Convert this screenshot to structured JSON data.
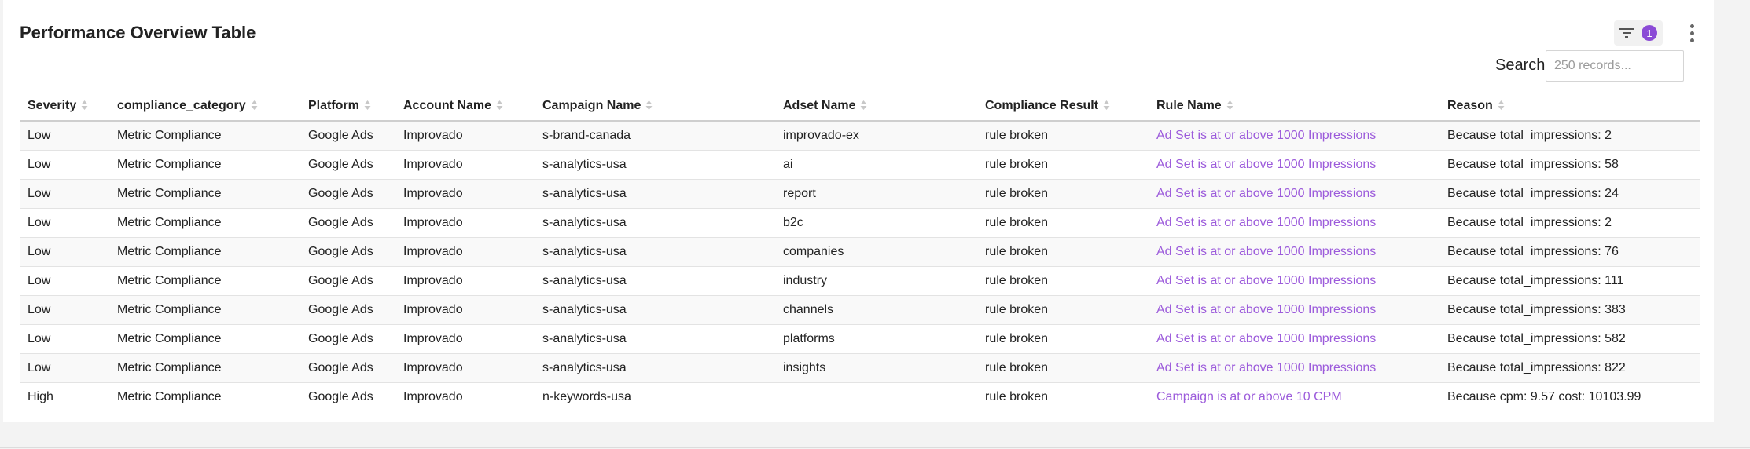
{
  "header": {
    "title": "Performance Overview Table",
    "filter_badge": "1",
    "filter_icon": "filter-icon",
    "menu_icon": "more-vertical-icon"
  },
  "search": {
    "label": "Search",
    "placeholder": "250 records...",
    "value": ""
  },
  "table": {
    "columns": [
      "Severity",
      "compliance_category",
      "Platform",
      "Account Name",
      "Campaign Name",
      "Adset Name",
      "Compliance Result",
      "Rule Name",
      "Reason"
    ],
    "rows": [
      [
        "Low",
        "Metric Compliance",
        "Google Ads",
        "Improvado",
        "s-brand-canada",
        "improvado-ex",
        "rule broken",
        "Ad Set is at or above 1000 Impressions",
        "Because total_impressions: 2"
      ],
      [
        "Low",
        "Metric Compliance",
        "Google Ads",
        "Improvado",
        "s-analytics-usa",
        "ai",
        "rule broken",
        "Ad Set is at or above 1000 Impressions",
        "Because total_impressions: 58"
      ],
      [
        "Low",
        "Metric Compliance",
        "Google Ads",
        "Improvado",
        "s-analytics-usa",
        "report",
        "rule broken",
        "Ad Set is at or above 1000 Impressions",
        "Because total_impressions: 24"
      ],
      [
        "Low",
        "Metric Compliance",
        "Google Ads",
        "Improvado",
        "s-analytics-usa",
        "b2c",
        "rule broken",
        "Ad Set is at or above 1000 Impressions",
        "Because total_impressions: 2"
      ],
      [
        "Low",
        "Metric Compliance",
        "Google Ads",
        "Improvado",
        "s-analytics-usa",
        "companies",
        "rule broken",
        "Ad Set is at or above 1000 Impressions",
        "Because total_impressions: 76"
      ],
      [
        "Low",
        "Metric Compliance",
        "Google Ads",
        "Improvado",
        "s-analytics-usa",
        "industry",
        "rule broken",
        "Ad Set is at or above 1000 Impressions",
        "Because total_impressions: 111"
      ],
      [
        "Low",
        "Metric Compliance",
        "Google Ads",
        "Improvado",
        "s-analytics-usa",
        "channels",
        "rule broken",
        "Ad Set is at or above 1000 Impressions",
        "Because total_impressions: 383"
      ],
      [
        "Low",
        "Metric Compliance",
        "Google Ads",
        "Improvado",
        "s-analytics-usa",
        "platforms",
        "rule broken",
        "Ad Set is at or above 1000 Impressions",
        "Because total_impressions: 582"
      ],
      [
        "Low",
        "Metric Compliance",
        "Google Ads",
        "Improvado",
        "s-analytics-usa",
        "insights",
        "rule broken",
        "Ad Set is at or above 1000 Impressions",
        "Because total_impressions: 822"
      ],
      [
        "High",
        "Metric Compliance",
        "Google Ads",
        "Improvado",
        "n-keywords-usa",
        "",
        "rule broken",
        "Campaign is at or above 10 CPM",
        "Because cpm: 9.57 cost: 10103.99"
      ]
    ]
  },
  "colors": {
    "accent": "#8b4bd6",
    "link": "#9c5bdb"
  }
}
